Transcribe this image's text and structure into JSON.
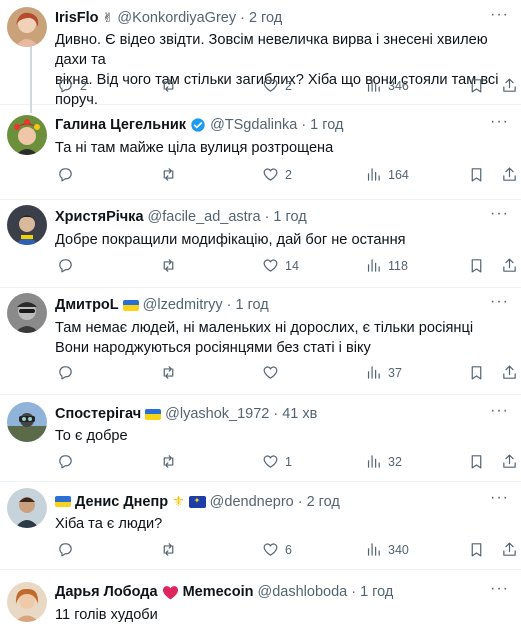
{
  "tweets": [
    {
      "name": "IrisFlo",
      "emoji": "✌",
      "handle": "@KonkordiyaGrey",
      "time": "2 год",
      "text": [
        "Дивно. Є відео звідти. Зовсім невеличка вирва і знесені хвилею дахи та",
        "вікна. Від чого там стільки загиблих? Хіба що вони стояли там всі поруч."
      ],
      "replies": "2",
      "retweets": "",
      "likes": "2",
      "views": "346"
    },
    {
      "name": "Галина Цегельник",
      "handle": "@TSgdalinka",
      "time": "1 год",
      "text": [
        "Та ні там майже ціла вулиця розтрощена"
      ],
      "replies": "",
      "retweets": "",
      "likes": "2",
      "views": "164"
    },
    {
      "name": "ХристяРічка",
      "handle": "@facile_ad_astra",
      "time": "1 год",
      "text": [
        "Добре покращили модифікацію, дай бог не остання"
      ],
      "replies": "",
      "retweets": "",
      "likes": "14",
      "views": "118"
    },
    {
      "name": "ДмитроL",
      "handle": "@lzedmitryy",
      "time": "1 год",
      "text": [
        "Там немає людей, ні маленьких ні дорослих, є тільки росіянці",
        "Вони народжуються росіянцями без статі і віку"
      ],
      "replies": "",
      "retweets": "",
      "likes": "",
      "views": "37"
    },
    {
      "name": "Спостерігач",
      "handle": "@lyashok_1972",
      "time": "41 хв",
      "text": [
        "То є добре"
      ],
      "replies": "",
      "retweets": "",
      "likes": "1",
      "views": "32"
    },
    {
      "name": "Денис Днепр",
      "handle": "@dendnepro",
      "time": "2 год",
      "text": [
        "Хіба та є люди?"
      ],
      "replies": "",
      "retweets": "",
      "likes": "6",
      "views": "340"
    },
    {
      "name": "Дарья Лобода",
      "name_suffix": "Memecoin",
      "handle": "@dashloboda",
      "time": "1 год",
      "text": [
        "11 голів худоби"
      ]
    }
  ],
  "separator": "·",
  "colors": {
    "verified": "#1d9bf0",
    "heart": "#e0245e",
    "thread_line": "#cfd9de",
    "muted": "#536471"
  }
}
